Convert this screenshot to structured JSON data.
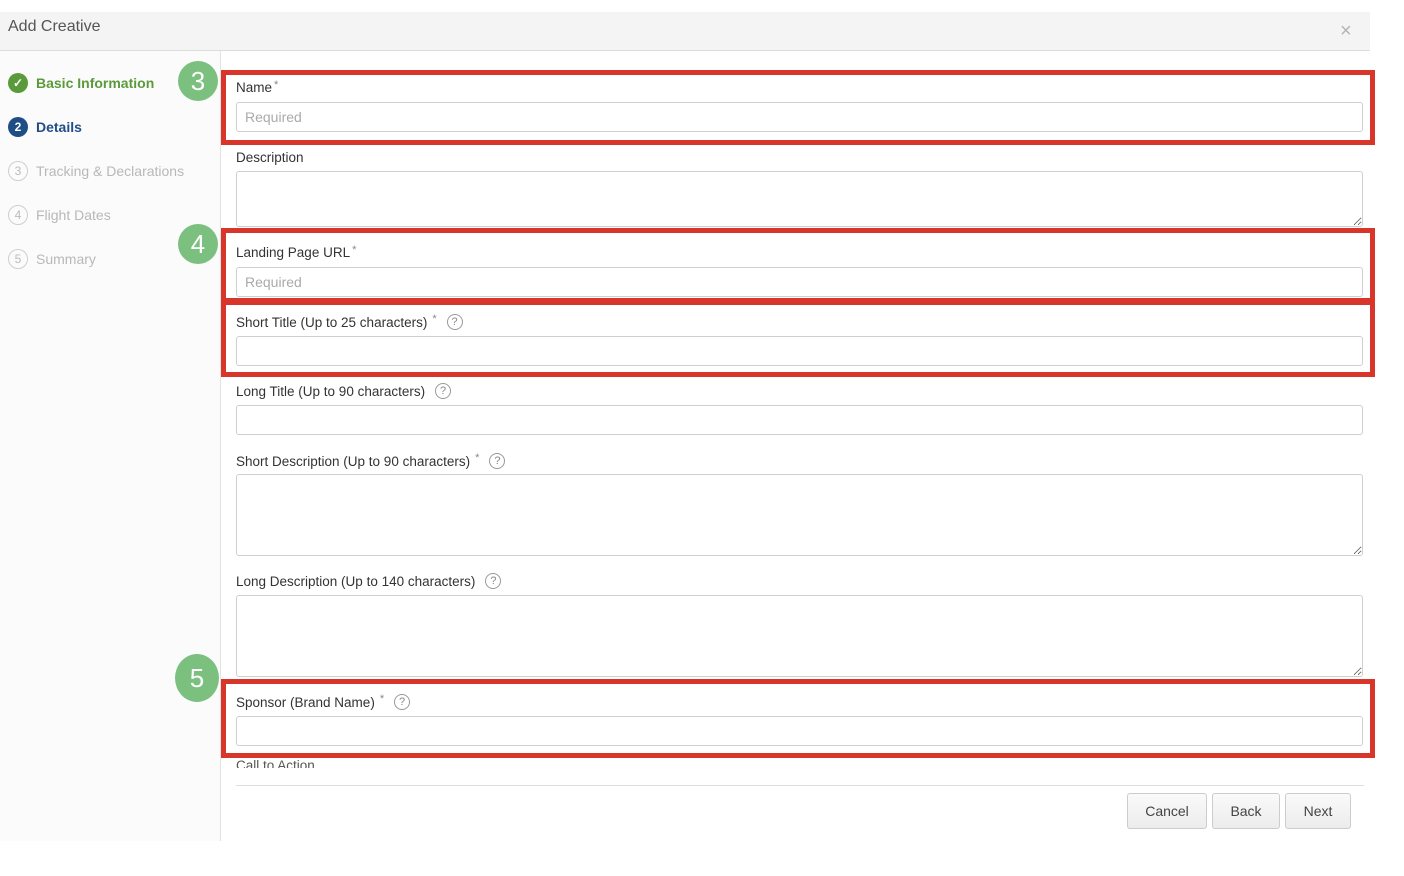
{
  "dialog": {
    "title": "Add Creative",
    "close_icon": "×"
  },
  "steps": [
    {
      "num": "✓",
      "label": "Basic Information",
      "state": "done"
    },
    {
      "num": "2",
      "label": "Details",
      "state": "active"
    },
    {
      "num": "3",
      "label": "Tracking & Declarations",
      "state": "pending"
    },
    {
      "num": "4",
      "label": "Flight Dates",
      "state": "pending"
    },
    {
      "num": "5",
      "label": "Summary",
      "state": "pending"
    }
  ],
  "fields": {
    "name": {
      "label": "Name",
      "required": "*",
      "placeholder": "Required",
      "value": ""
    },
    "description": {
      "label": "Description",
      "value": ""
    },
    "landing_url": {
      "label": "Landing Page URL",
      "required": "*",
      "placeholder": "Required",
      "value": ""
    },
    "short_title": {
      "label": "Short Title (Up to 25 characters)",
      "required": "*",
      "value": ""
    },
    "long_title": {
      "label": "Long Title (Up to 90 characters)",
      "value": ""
    },
    "short_desc": {
      "label": "Short Description (Up to 90 characters)",
      "required": "*",
      "value": ""
    },
    "long_desc": {
      "label": "Long Description (Up to 140 characters)",
      "value": ""
    },
    "sponsor": {
      "label": "Sponsor (Brand Name)",
      "required": "*",
      "value": ""
    },
    "cta": {
      "label": "Call to Action"
    }
  },
  "help_icon": "?",
  "annotations": {
    "badge3": "3",
    "badge4": "4",
    "badge5": "5"
  },
  "buttons": {
    "cancel": "Cancel",
    "back": "Back",
    "next": "Next"
  },
  "colors": {
    "highlight": "#d9362b",
    "badge": "#7cc07f",
    "done": "#5b9a3a",
    "active": "#1f4e86"
  }
}
